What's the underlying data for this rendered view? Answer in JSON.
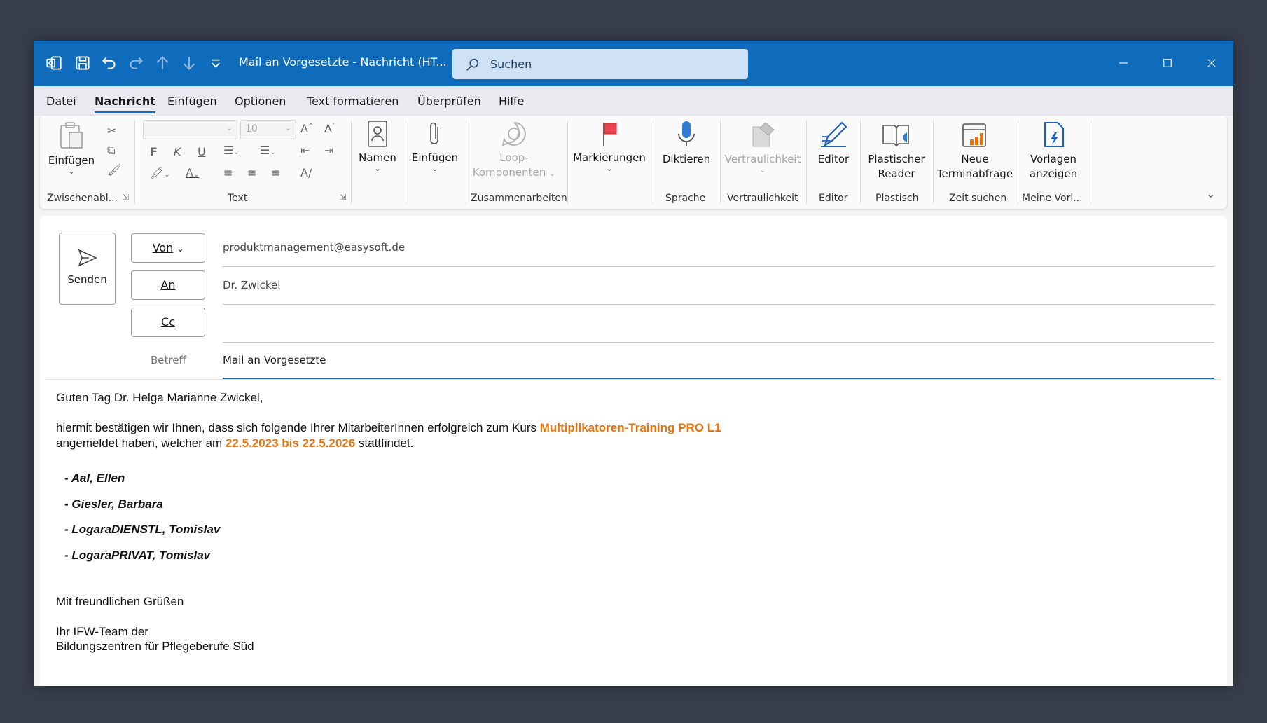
{
  "titlebar": {
    "title": "Mail an Vorgesetzte  -  Nachricht (HT...",
    "search_placeholder": "Suchen",
    "accent": "#0f6cbd"
  },
  "menu": {
    "items": [
      "Datei",
      "Nachricht",
      "Einfügen",
      "Optionen",
      "Text formatieren",
      "Überprüfen",
      "Hilfe"
    ],
    "active": "Nachricht"
  },
  "ribbon": {
    "clipboard": {
      "paste": "Einfügen",
      "group": "Zwischenabl..."
    },
    "text": {
      "font_size": "10",
      "group": "Text"
    },
    "names": {
      "label": "Namen"
    },
    "insert": {
      "label": "Einfügen"
    },
    "loop": {
      "label1": "Loop-",
      "label2": "Komponenten",
      "group": "Zusammenarbeiten"
    },
    "tags": {
      "label": "Markierungen"
    },
    "dictate": {
      "label": "Diktieren",
      "group": "Sprache"
    },
    "sensitivity": {
      "label": "Vertraulichkeit",
      "group": "Vertraulichkeit"
    },
    "editor": {
      "label": "Editor",
      "group": "Editor"
    },
    "immersive": {
      "label1": "Plastischer",
      "label2": "Reader",
      "group": "Plastisch"
    },
    "findtime": {
      "label1": "Neue",
      "label2": "Terminabfrage",
      "group": "Zeit suchen"
    },
    "templates": {
      "label1": "Vorlagen",
      "label2": "anzeigen",
      "group": "Meine Vorl..."
    }
  },
  "compose": {
    "send_label": "Senden",
    "from_label": "Von",
    "from_value": "produktmanagement@easysoft.de",
    "to_label": "An",
    "to_value": "Dr. Zwickel",
    "cc_label": "Cc",
    "cc_value": "",
    "subject_label": "Betreff",
    "subject_value": "Mail an Vorgesetzte"
  },
  "body": {
    "greeting": "Guten Tag Dr. Helga Marianne Zwickel,",
    "line1_pre": "hiermit bestätigen wir Ihnen, dass sich folgende Ihrer MitarbeiterInnen erfolgreich zum Kurs ",
    "course": "Multiplikatoren-Training PRO L1",
    "line2_pre": "angemeldet haben, welcher am ",
    "dates": "22.5.2023 bis 22.5.2026",
    "line2_post": " stattfindet.",
    "participants": [
      "- Aal, Ellen",
      "- Giesler, Barbara",
      "- LogaraDIENSTL, Tomislav",
      "- LogaraPRIVAT, Tomislav"
    ],
    "closing": "Mit freundlichen Grüßen",
    "sign1": "Ihr IFW-Team der",
    "sign2": "Bildungszentren für Pflegeberufe Süd",
    "highlight_color": "#e8720c"
  }
}
